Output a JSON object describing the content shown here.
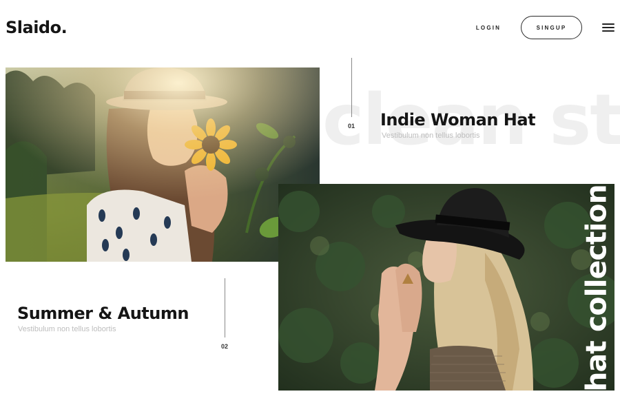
{
  "header": {
    "logo": "Slaido.",
    "nav": {
      "login_label": "LOGIN",
      "signup_label": "SINGUP"
    },
    "menu_icon": "hamburger-icon"
  },
  "background_text": "clean sty",
  "slides": [
    {
      "number": "01",
      "title": "Indie Woman Hat",
      "subtitle": "Vestibulum non tellus lobortis",
      "image": "woman-with-sunflower-photo"
    },
    {
      "number": "02",
      "title": "Summer & Autumn",
      "subtitle": "Vestibulum non tellus lobortis",
      "image": "woman-in-black-hat-photo"
    }
  ],
  "overlay_text": "hat collection",
  "colors": {
    "text": "#151515",
    "muted": "#bdbdbd",
    "watermark": "#efefef",
    "background": "#ffffff"
  }
}
